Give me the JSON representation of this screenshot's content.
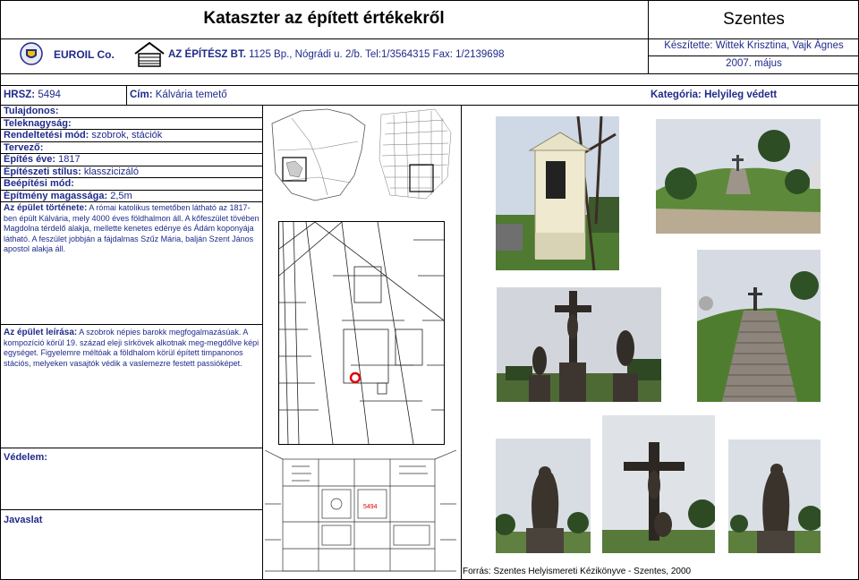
{
  "header": {
    "title": "Kataszter az épített értékekről",
    "city": "Szentes",
    "company1": "EUROIL Co.",
    "company2_name": "AZ ÉPÍTÉSZ BT.",
    "company2_address": "1125 Bp., Nógrádi u. 2/b. Tel:1/3564315 Fax: 1/2139698",
    "prepared_by": "Készítette: Wittek Krisztina, Vajk Ágnes",
    "date": "2007. május"
  },
  "info": {
    "hrsz_label": "HRSZ:",
    "hrsz_value": "5494",
    "cim_label": "Cím:",
    "cim_value": "Kálvária temető",
    "kategoria": "Kategória: Helyileg védett",
    "tulajdonos_label": "Tulajdonos:",
    "teleknagysag_label": "Teleknagyság:",
    "rendeltetes_label": "Rendeltetési mód:",
    "rendeltetes_value": "szobrok, stációk",
    "tervezo_label": "Tervező:",
    "epites_label": "Építés éve:",
    "epites_value": "1817",
    "stilus_label": "Építészeti stílus:",
    "stilus_value": "klasszicizáló",
    "beepitesi_label": "Beépítési mód:",
    "magassag_label": "Építmény magassága:",
    "magassag_value": "2,5m",
    "tortenet_label": "Az épület története:",
    "tortenet_text": "A római katolikus temetőben látható az 1817-ben épült Kálvária, mely 4000 éves földhalmon áll. A kőfeszület tövében Magdolna térdelő alakja, mellette kenetes edénye és Ádám koponyája látható. A feszület jobbján a fájdalmas Szűz Mária, balján Szent János apostol alakja áll.",
    "leiras_label": "Az épület leírása:",
    "leiras_text": "A szobrok népies barokk megfogalmazásúak. A kompozíció körül 19. század eleji sírkövek alkotnak meg-megdőlve képi egységet. Figyelemre méltóak a földhalom körül épített timpanonos stációs, melyeken vasajtók védik a vaslemezre festett passióképet.",
    "vedelem_label": "Védelem:",
    "javaslat_label": "Javaslat"
  },
  "map_label": "5494",
  "source": "Forrás: Szentes Helyismereti Kézikönyve - Szentes, 2000",
  "colors": {
    "label_blue": "#1f2a8a",
    "marker_red": "#e00000"
  }
}
